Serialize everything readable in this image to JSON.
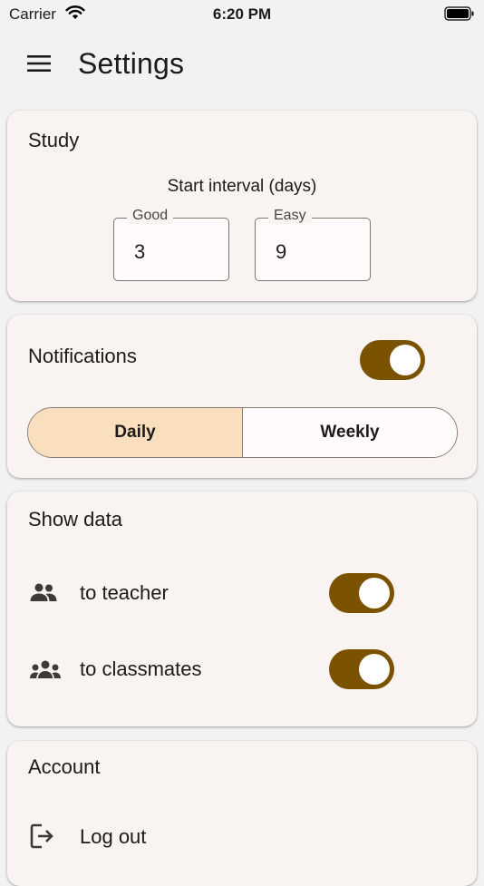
{
  "status_bar": {
    "carrier": "Carrier",
    "time": "6:20 PM"
  },
  "app_bar": {
    "title": "Settings",
    "menu_icon": "hamburger-menu-icon"
  },
  "study": {
    "title": "Study",
    "interval_label": "Start interval (days)",
    "good_label": "Good",
    "good_value": "3",
    "easy_label": "Easy",
    "easy_value": "9"
  },
  "notifications": {
    "title": "Notifications",
    "enabled": true,
    "options": [
      "Daily",
      "Weekly"
    ],
    "selected": "Daily"
  },
  "show_data": {
    "title": "Show data",
    "teacher_label": "to teacher",
    "teacher_icon": "people-icon",
    "teacher_enabled": true,
    "classmates_label": "to classmates",
    "classmates_icon": "groups-icon",
    "classmates_enabled": true
  },
  "account": {
    "title": "Account",
    "logout_label": "Log out",
    "logout_icon": "logout-icon"
  },
  "colors": {
    "accent": "#7a5200",
    "selected_segment": "#f9dfbd",
    "card_background": "#f9f3f1",
    "page_background": "#f2f2f2"
  }
}
